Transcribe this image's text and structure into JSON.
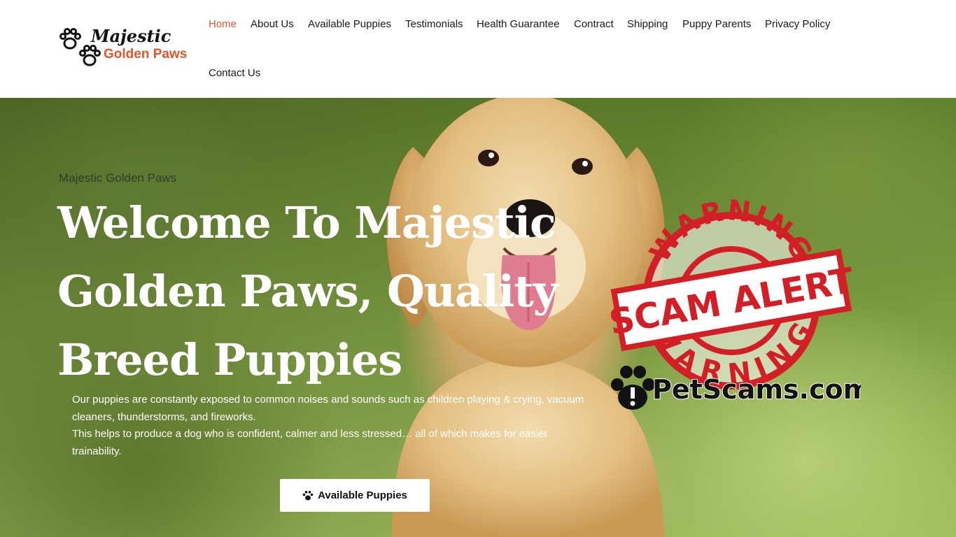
{
  "header": {
    "logo": {
      "line1": "Majestic",
      "line2": "Golden Paws",
      "icon": "paw-prints-icon"
    },
    "nav": [
      {
        "label": "Home",
        "active": true
      },
      {
        "label": "About Us",
        "active": false
      },
      {
        "label": "Available Puppies",
        "active": false
      },
      {
        "label": "Testimonials",
        "active": false
      },
      {
        "label": "Health Guarantee",
        "active": false
      },
      {
        "label": "Contract",
        "active": false
      },
      {
        "label": "Shipping",
        "active": false
      },
      {
        "label": "Puppy Parents",
        "active": false
      },
      {
        "label": "Privacy Policy",
        "active": false
      },
      {
        "label": "Contact Us",
        "active": false
      }
    ]
  },
  "hero": {
    "eyebrow": "Majestic Golden Paws",
    "headline": "Welcome To Majestic Golden Paws, Quality Breed Puppies",
    "intro_line1": "Our puppies are constantly exposed to common noises and sounds such as children playing & crying, vacuum cleaners, thunderstorms, and fireworks.",
    "intro_line2": "This helps to produce a dog who is confident, calmer and less stressed… all of which makes for easier trainability.",
    "cta_label": "Available Puppies",
    "cta_icon": "paw-icon"
  },
  "overlay": {
    "ring_top": "WARNING",
    "ring_bottom": "WARNING",
    "stamp": "SCAM ALERT",
    "site": "PetScams.com",
    "site_icon": "paw-alert-icon"
  },
  "colors": {
    "accent": "#e0572f",
    "warning_red": "#d21f26"
  }
}
